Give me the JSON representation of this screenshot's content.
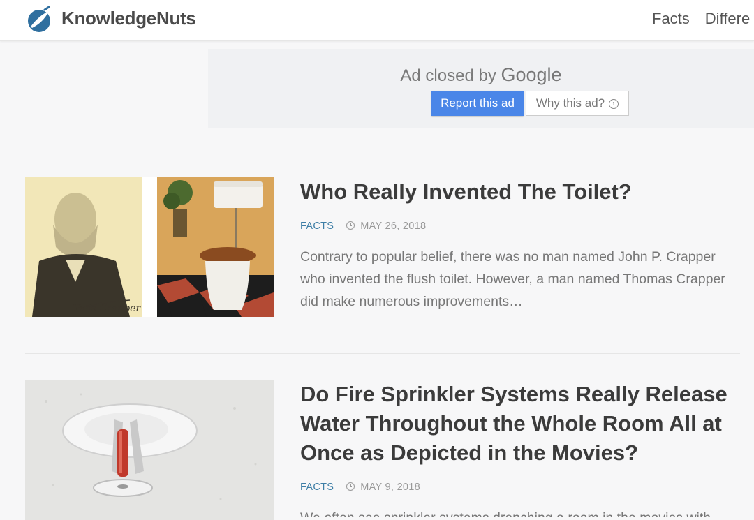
{
  "header": {
    "brand": "KnowledgeNuts",
    "nav": [
      "Facts",
      "Differe"
    ]
  },
  "ad": {
    "closed_text": "Ad closed by",
    "google": "Google",
    "report_label": "Report this ad",
    "why_label": "Why this ad?",
    "info_glyph": "i"
  },
  "articles": [
    {
      "title": "Who Really Invented The Toilet?",
      "category": "FACTS",
      "date": "MAY 26, 2018",
      "excerpt": "Contrary to popular belief, there was no man named John P. Crapper who invented the flush toilet. However, a man named Thomas Crapper did make numerous improvements…",
      "image_signature": "Thos Crapper"
    },
    {
      "title": "Do Fire Sprinkler Systems Really Release Water Throughout the Whole Room All at Once as Depicted in the Movies?",
      "category": "FACTS",
      "date": "MAY 9, 2018",
      "excerpt": "We often see sprinkler systems drenching a room in the movies with"
    }
  ],
  "colors": {
    "category": "#3d7ea6",
    "report_button": "#4a86e8",
    "logo": "#2f6f9f"
  },
  "icons": [
    "logo-icon",
    "clock-icon",
    "info-icon"
  ]
}
